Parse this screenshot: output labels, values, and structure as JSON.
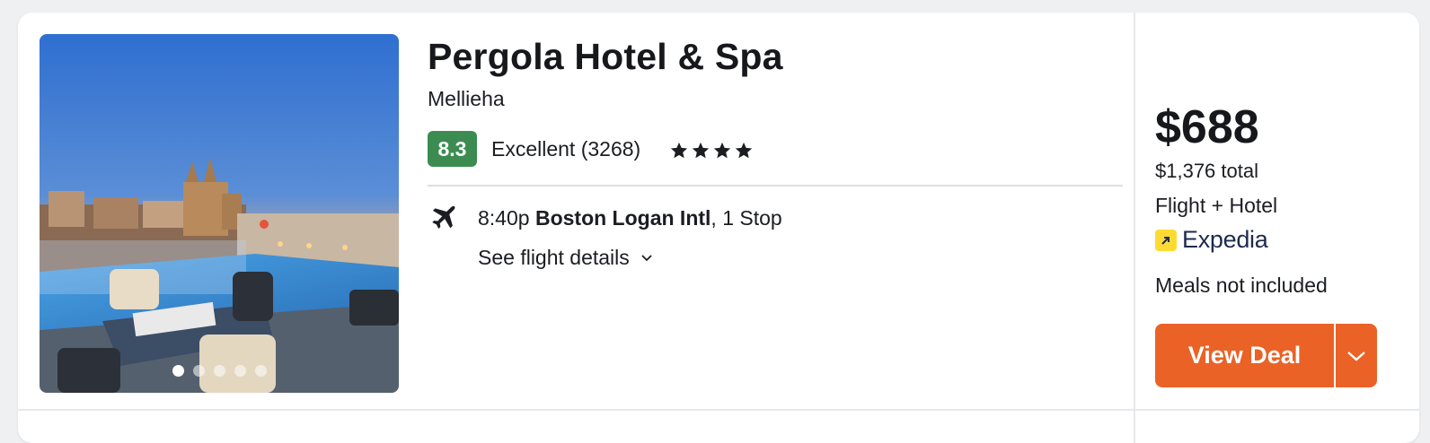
{
  "hotel": {
    "name": "Pergola Hotel & Spa",
    "location": "Mellieha",
    "score": "8.3",
    "rating_text": "Excellent (3268)",
    "stars": 4,
    "photo": {
      "slide_count": 5,
      "active_slide_index": 0
    }
  },
  "flight": {
    "departure_time": "8:40p",
    "airport": "Boston Logan Intl",
    "stops": ", 1 Stop",
    "details_link": "See flight details"
  },
  "price": {
    "per_person": "$688",
    "total": "$1,376 total",
    "package_type": "Flight + Hotel",
    "provider": "Expedia",
    "meals": "Meals not included"
  },
  "actions": {
    "view_deal": "View Deal"
  },
  "colors": {
    "score_bg": "#3c8c52",
    "deal_button": "#ea6226",
    "provider_logo": "#fddb32"
  },
  "icons": [
    "plane-icon",
    "chevron-down-icon",
    "star-icon",
    "expedia-logo-icon"
  ]
}
